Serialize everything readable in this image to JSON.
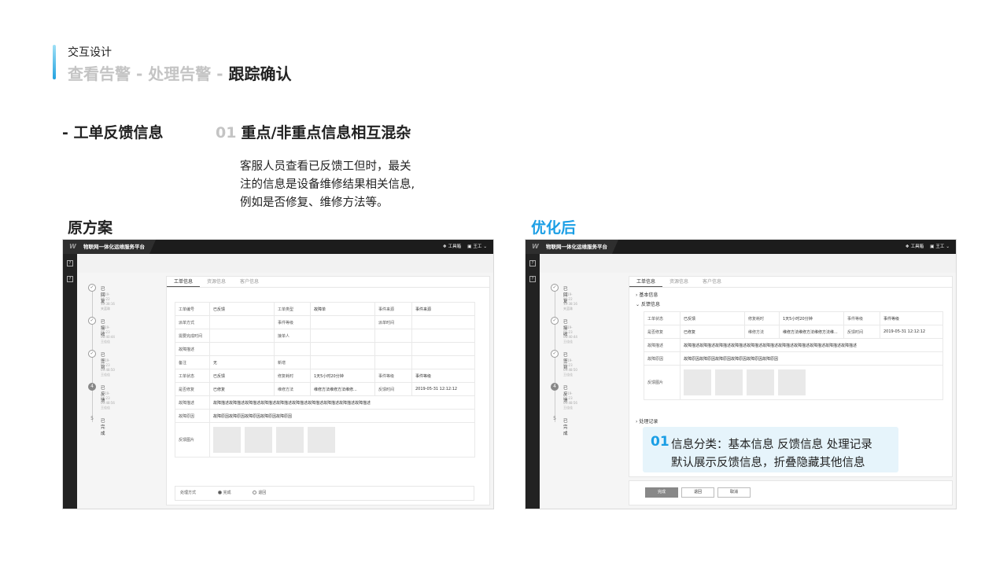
{
  "header": {
    "label": "交互设计",
    "crumb_1": "查看告警",
    "sep_1": " - ",
    "crumb_2": "处理告警",
    "sep_2": " - ",
    "crumb_current": "跟踪确认"
  },
  "section": {
    "title": "- 工单反馈信息",
    "point_num": "01",
    "point_title": "重点/非重点信息相互混杂",
    "desc": [
      "客服人员查看已反馈工但时，最关",
      "注的信息是设备维修结果相关信息,",
      "例如是否修复、维修方法等。"
    ]
  },
  "labels": {
    "original": "原方案",
    "optimized": "优化后"
  },
  "app": {
    "platform_title": "物联网一体化运维服务平台",
    "logo": "W",
    "toolbox": "工具箱",
    "user": "王工",
    "tabs": [
      "工单信息",
      "资源信息",
      "客户信息"
    ]
  },
  "steps": [
    {
      "no": "1",
      "title": "已回复",
      "date": "2019-05-22 10:38:16",
      "person": "夹蓝珠"
    },
    {
      "no": "2",
      "title": "已接收",
      "date": "2019-05-23 08:40:44",
      "person": "王佳佳"
    },
    {
      "no": "3",
      "title": "已签到",
      "date": "2019-05-23 09:48:50",
      "person": "王佳佳"
    },
    {
      "no": "4",
      "title": "已反馈",
      "date": "2019-05-23 09:48:56",
      "person": "王佳佳"
    },
    {
      "no": "5",
      "title": "已完成",
      "date": "",
      "person": ""
    }
  ],
  "original": {
    "rows": [
      [
        "工单编号",
        "已反馈",
        "工单类型",
        "故障单",
        "事件来源",
        "事件来源"
      ],
      [
        "派单方式",
        "",
        "事件等级",
        "",
        "派单时间",
        ""
      ],
      [
        "需要完成时间",
        "",
        "接单人",
        "",
        "",
        ""
      ],
      [
        "故障描述",
        "",
        "",
        "",
        "",
        ""
      ],
      [
        "备注",
        "无",
        "新增",
        "",
        "",
        ""
      ],
      [
        "工单状态",
        "已反馈",
        "修复耗时",
        "1天5小时20分钟",
        "事件等级",
        "事件等级"
      ],
      [
        "是否修复",
        "已修复",
        "维修方法",
        "维修方法维修方法维修...",
        "反馈时间",
        "2019-05-31 12:12:12"
      ]
    ],
    "fault_desc_label": "故障描述",
    "fault_desc": "故障描述故障描述故障描述故障描述故障描述故障描述故障描述故障描述故障描述故障描述",
    "fault_reason_label": "故障原因",
    "fault_reason": "故障原因故障原因故障原因故障原因故障原因",
    "images_label": "反馈图片",
    "process_label": "处理方式",
    "opt_done": "完成",
    "opt_return": "退回"
  },
  "optimized": {
    "basic": "基本信息",
    "feedback": "反馈信息",
    "records": "处理记录",
    "rows": [
      [
        "工单状态",
        "已反馈",
        "修复耗时",
        "1天5小时20分钟",
        "事件等级",
        "事件等级"
      ],
      [
        "是否修复",
        "已修复",
        "维修方法",
        "维修方法维修方法维修方法维...",
        "反馈时间",
        "2019-05-31 12:12:12"
      ]
    ],
    "fault_desc_label": "故障描述",
    "fault_desc": "故障描述故障描述故障描述故障描述故障描述故障描述故障描述故障描述故障描述故障描述故障描述",
    "fault_reason_label": "故障原因",
    "fault_reason": "故障原因故障原因故障原因故障原因故障原因故障原因",
    "images_label": "反馈图片",
    "btn_done": "完成",
    "btn_return": "退回",
    "btn_cancel": "取消",
    "callout_num": "01",
    "callout_l1": "信息分类：基本信息 反馈信息 处理记录",
    "callout_l2": "默认展示反馈信息，折叠隐藏其他信息"
  }
}
